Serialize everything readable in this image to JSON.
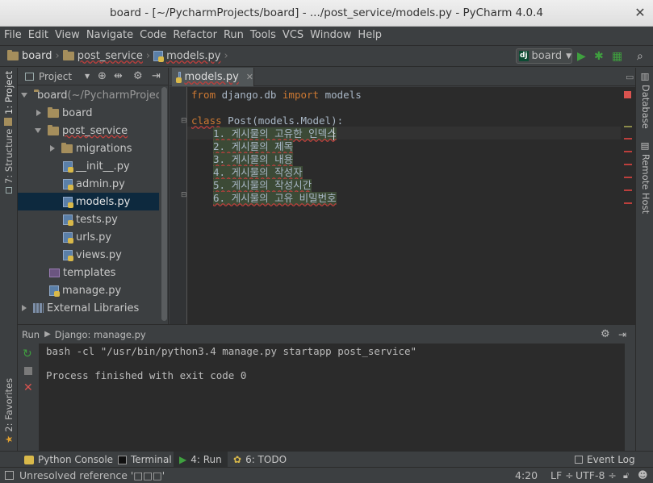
{
  "window": {
    "title": "board - [~/PycharmProjects/board] - .../post_service/models.py - PyCharm 4.0.4"
  },
  "menu": [
    "File",
    "Edit",
    "View",
    "Navigate",
    "Code",
    "Refactor",
    "Run",
    "Tools",
    "VCS",
    "Window",
    "Help"
  ],
  "breadcrumbs": {
    "root": "board",
    "folder": "post_service",
    "file": "models.py"
  },
  "run_config": {
    "icon_text": "dj",
    "label": "board"
  },
  "left_stripe": {
    "project": "1: Project",
    "structure": "7: Structure",
    "favorites": "2: Favorites"
  },
  "right_stripe": {
    "database": "Database",
    "remote": "Remote Host"
  },
  "project_panel": {
    "header": "Project",
    "items": [
      {
        "label": "board",
        "suffix": " (~/PycharmProjects/board)"
      },
      {
        "label": "board"
      },
      {
        "label": "post_service"
      },
      {
        "label": "migrations"
      },
      {
        "label": "__init__.py"
      },
      {
        "label": "admin.py"
      },
      {
        "label": "models.py"
      },
      {
        "label": "tests.py"
      },
      {
        "label": "urls.py"
      },
      {
        "label": "views.py"
      },
      {
        "label": "templates"
      },
      {
        "label": "manage.py"
      },
      {
        "label": "External Libraries"
      }
    ]
  },
  "editor": {
    "tab_label": "models.py",
    "code": {
      "l1_from": "from",
      "l1_mod": " django.db ",
      "l1_import": "import",
      "l1_rest": " models",
      "l3_class": "class",
      "l3_rest": " Post(models.Model):",
      "l4": "1. 게시물의 고유한 인덱스",
      "l5": "2. 게시물의 제목",
      "l6": "3. 게시물의 내용",
      "l7": "4. 게시물의 작성자",
      "l8": "5. 게시물의 작성시간",
      "l9": "6. 게시물의 고유 비밀번호"
    }
  },
  "run_panel": {
    "label": "Run",
    "config": "Django: manage.py",
    "console_cmd": "bash -cl \"/usr/bin/python3.4 manage.py startapp post_service\"",
    "console_status": "Process finished with exit code 0"
  },
  "bottom_tabs": {
    "python_console": "Python Console",
    "terminal": "Terminal",
    "run": "4: Run",
    "todo": "6: TODO",
    "event_log": "Event Log"
  },
  "status_bar": {
    "message": "Unresolved reference '□□□'",
    "position": "4:20",
    "line_sep": "LF ÷",
    "encoding": "UTF-8 ÷"
  },
  "colors": {
    "keyword": "#cc7832",
    "code_text": "#a9b7c6",
    "error_mark": "#bc3f3c",
    "run_green": "#3fa03f"
  }
}
